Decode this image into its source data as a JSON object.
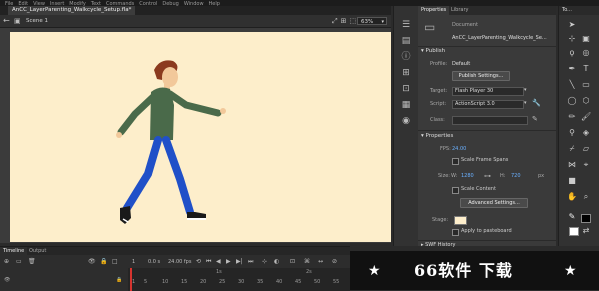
{
  "menubar": {
    "items": [
      "File",
      "Edit",
      "View",
      "Insert",
      "Modify",
      "Text",
      "Commands",
      "Control",
      "Debug",
      "Window",
      "Help"
    ]
  },
  "document": {
    "tab_title": "AnCC_LayerParenting_Walkcycle_Setup.fla*",
    "scene_label": "Scene 1",
    "zoom": "63%"
  },
  "stage": {
    "background_color": "#fdeecb"
  },
  "properties_panel": {
    "tabs": [
      "Properties",
      "Library"
    ],
    "doc_type": "Document",
    "doc_name": "AnCC_LayerParenting_Walkcycle_Se...",
    "publish": {
      "header": "Publish",
      "profile_label": "Profile:",
      "profile_value": "Default",
      "publish_settings_button": "Publish Settings...",
      "target_label": "Target:",
      "target_value": "Flash Player 30",
      "script_label": "Script:",
      "script_value": "ActionScript 3.0",
      "class_label": "Class:",
      "class_value": ""
    },
    "properties": {
      "header": "Properties",
      "fps_label": "FPS:",
      "fps_value": "24.00",
      "scale_frame_spans": "Scale Frame Spans",
      "size_label": "Size:",
      "w_label": "W:",
      "w_value": "1280",
      "h_label": "H:",
      "h_value": "720",
      "unit": "px",
      "scale_content": "Scale Content",
      "advanced_settings_button": "Advanced Settings...",
      "stage_label": "Stage:",
      "stage_color": "#fdeecb",
      "apply_to_pasteboard": "Apply to pasteboard",
      "swf_history": "SWF History"
    }
  },
  "tools_panel": {
    "header": "To..."
  },
  "timeline": {
    "tabs": [
      "Timeline",
      "Output"
    ],
    "current_frame": "1",
    "time": "0.0 s",
    "fps": "24.00 fps",
    "ruler_seconds": [
      "1s",
      "2s"
    ],
    "ruler_frames": [
      "1",
      "5",
      "10",
      "15",
      "20",
      "25",
      "30",
      "35",
      "40",
      "45",
      "50",
      "55"
    ]
  },
  "watermark": {
    "text": "66软件 下载"
  }
}
